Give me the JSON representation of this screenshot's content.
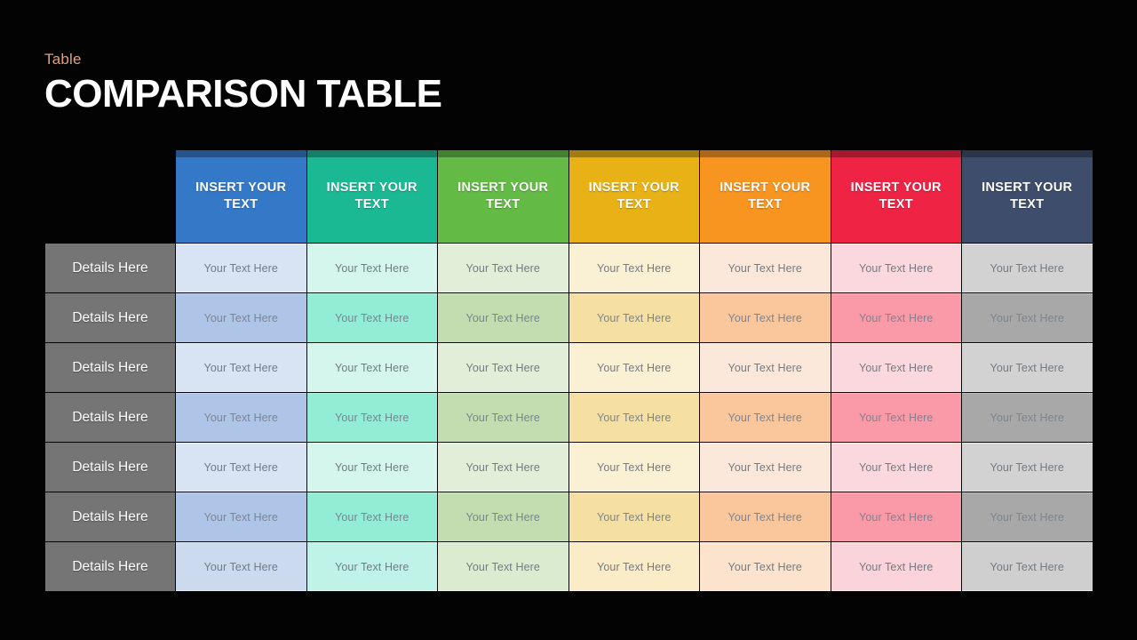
{
  "slide": {
    "background_color": "#030303",
    "eyebrow": "Table",
    "eyebrow_color": "#e2a178",
    "title": "COMPARISON TABLE",
    "title_color": "#ffffff"
  },
  "table": {
    "corner_label": "",
    "row_label_color": "#757575",
    "columns": [
      {
        "header": "INSERT YOUR TEXT",
        "header_color": "#3479c8",
        "tint_light": "#d8e4f4",
        "tint_strong": "#aec5e8",
        "tint_last": "#ccdaf0"
      },
      {
        "header": "INSERT YOUR TEXT",
        "header_color": "#1bb894",
        "tint_light": "#d4f6ed",
        "tint_strong": "#93ecd4",
        "tint_last": "#bff3e7"
      },
      {
        "header": "INSERT YOUR TEXT",
        "header_color": "#63bb46",
        "tint_light": "#e2efd8",
        "tint_strong": "#c3ddb0",
        "tint_last": "#dbebd0"
      },
      {
        "header": "INSERT YOUR TEXT",
        "header_color": "#e8b216",
        "tint_light": "#faf0d4",
        "tint_strong": "#f5dfa2",
        "tint_last": "#fbecc8"
      },
      {
        "header": "INSERT YOUR TEXT",
        "header_color": "#f89420",
        "tint_light": "#fbe8da",
        "tint_strong": "#f9c79b",
        "tint_last": "#fbe3cd"
      },
      {
        "header": "INSERT YOUR TEXT",
        "header_color": "#ef2343",
        "tint_light": "#fbd8de",
        "tint_strong": "#fa9aa9",
        "tint_last": "#fbd3da"
      },
      {
        "header": "INSERT YOUR TEXT",
        "header_color": "#3e4d6b",
        "tint_light": "#d2d2d2",
        "tint_strong": "#a8a8a8",
        "tint_last": "#cfcfcf"
      }
    ],
    "rows": [
      {
        "label": "Details Here",
        "cells": [
          "Your Text Here",
          "Your Text Here",
          "Your Text Here",
          "Your Text Here",
          "Your Text Here",
          "Your Text Here",
          "Your Text Here"
        ]
      },
      {
        "label": "Details Here",
        "cells": [
          "Your Text Here",
          "Your Text Here",
          "Your Text Here",
          "Your Text Here",
          "Your Text Here",
          "Your Text Here",
          "Your Text Here"
        ]
      },
      {
        "label": "Details Here",
        "cells": [
          "Your Text Here",
          "Your Text Here",
          "Your Text Here",
          "Your Text Here",
          "Your Text Here",
          "Your Text Here",
          "Your Text Here"
        ]
      },
      {
        "label": "Details Here",
        "cells": [
          "Your Text Here",
          "Your Text Here",
          "Your Text Here",
          "Your Text Here",
          "Your Text Here",
          "Your Text Here",
          "Your Text Here"
        ]
      },
      {
        "label": "Details Here",
        "cells": [
          "Your Text Here",
          "Your Text Here",
          "Your Text Here",
          "Your Text Here",
          "Your Text Here",
          "Your Text Here",
          "Your Text Here"
        ]
      },
      {
        "label": "Details Here",
        "cells": [
          "Your Text Here",
          "Your Text Here",
          "Your Text Here",
          "Your Text Here",
          "Your Text Here",
          "Your Text Here",
          "Your Text Here"
        ]
      },
      {
        "label": "Details Here",
        "cells": [
          "Your Text Here",
          "Your Text Here",
          "Your Text Here",
          "Your Text Here",
          "Your Text Here",
          "Your Text Here",
          "Your Text Here"
        ]
      }
    ]
  }
}
